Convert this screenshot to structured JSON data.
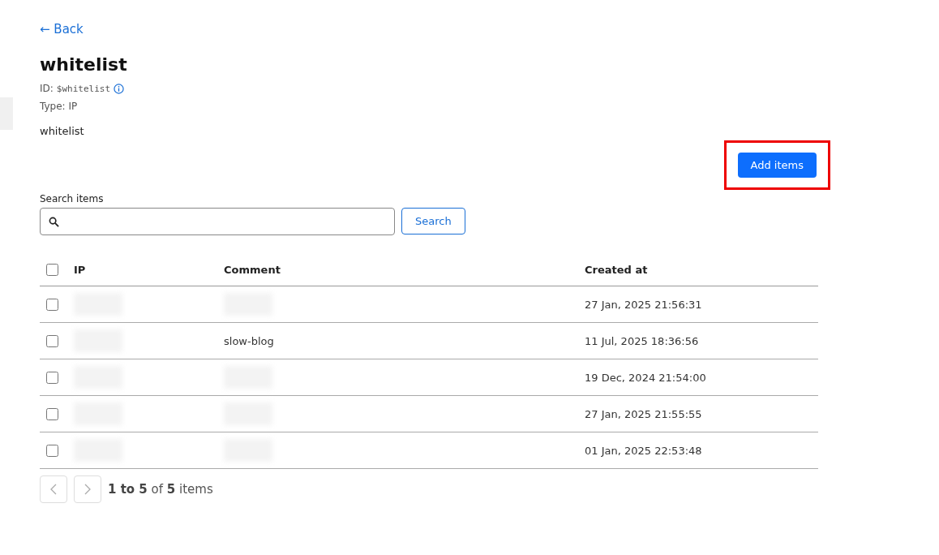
{
  "back_link": {
    "icon": "←",
    "label": "Back"
  },
  "title": "whitelist",
  "id_label": "ID:",
  "id_value": "$whitelist",
  "type_line": "Type: IP",
  "description": "whitelist",
  "add_button": {
    "label": "Add items",
    "highlighted": true
  },
  "search": {
    "label": "Search items",
    "button": "Search"
  },
  "table": {
    "all_checked": false,
    "columns": [
      "IP",
      "Comment",
      "Created at"
    ],
    "rows": [
      {
        "checked": false,
        "ip": "",
        "comment": "",
        "created": "27 Jan, 2025 21:56:31"
      },
      {
        "checked": false,
        "ip": "",
        "comment": "slow-blog",
        "created": "11 Jul, 2025 18:36:56"
      },
      {
        "checked": false,
        "ip": "",
        "comment": "",
        "created": "19 Dec, 2024 21:54:00"
      },
      {
        "checked": false,
        "ip": "",
        "comment": "",
        "created": "27 Jan, 2025 21:55:55"
      },
      {
        "checked": false,
        "ip": "",
        "comment": "",
        "created": "01 Jan, 2025 22:53:48"
      }
    ]
  },
  "pagination": {
    "summary": "**1 to 5** of **5** items"
  }
}
